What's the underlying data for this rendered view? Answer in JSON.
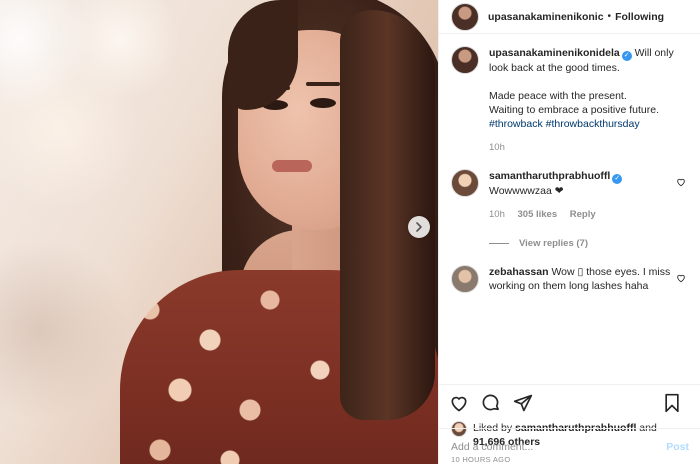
{
  "header": {
    "username": "upasanakaminenikonic",
    "separator": "•",
    "follow_state": "Following"
  },
  "caption": {
    "username": "upasanakaminenikonidela",
    "verified_mark": "✓",
    "line1": "Will only look back at the good times.",
    "line2": "Made peace with the present.",
    "line3": "Waiting to embrace a positive future.",
    "hashtag1": "#throwback",
    "hashtag2": "#throwbackthursday",
    "time": "10h"
  },
  "comments": [
    {
      "username": "samantharuthprabhuoffl",
      "verified_mark": "✓",
      "text": "Wowwwwzaa ❤",
      "time": "10h",
      "likes": "305 likes",
      "reply_label": "Reply",
      "view_replies": "View replies (7)"
    },
    {
      "username": "zebahassan",
      "text": "Wow ▯ those eyes. I miss working on them long lashes haha"
    }
  ],
  "likes": {
    "prefix": "Liked by",
    "user": "samantharuthprabhuoffl",
    "and": "and",
    "others": "91,696 others"
  },
  "timestamp": "10 HOURS AGO",
  "add_comment": {
    "placeholder": "Add a comment...",
    "post_label": "Post"
  },
  "icons": [
    "next-arrow-icon",
    "heart-icon",
    "comment-icon",
    "share-icon",
    "bookmark-icon",
    "verified-icon"
  ],
  "colors": {
    "verified": "#3897f0",
    "hashtag": "#00376b",
    "muted": "#8e8e8e",
    "post_button_disabled": "#b3dbff"
  }
}
